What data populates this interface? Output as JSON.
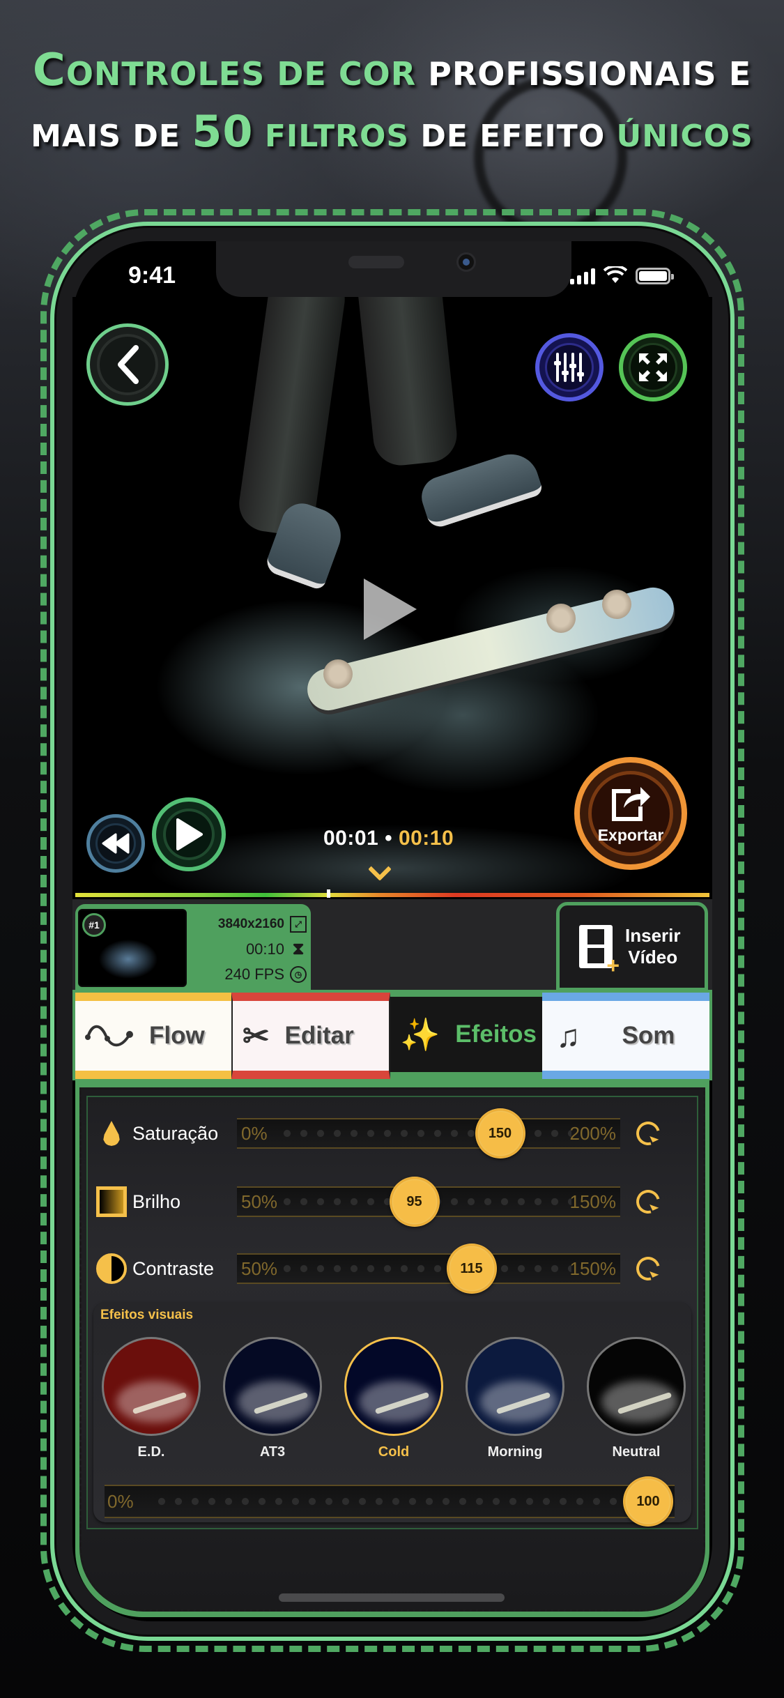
{
  "headline": {
    "line1": [
      {
        "text": "C",
        "color": "green",
        "cap": true
      },
      {
        "text": "ONTROLES DE COR ",
        "color": "green"
      },
      {
        "text": "PROFISSIONAIS E",
        "color": "white"
      }
    ],
    "line2": [
      {
        "text": "MAIS DE ",
        "color": "white"
      },
      {
        "text": "50",
        "color": "green",
        "big": true
      },
      {
        "text": " FILTROS ",
        "color": "green"
      },
      {
        "text": "DE EFEITO ",
        "color": "white"
      },
      {
        "text": "ÚNICOS",
        "color": "green"
      }
    ],
    "full_text": "Controles de cor profissionais e mais de 50 filtros de efeito únicos"
  },
  "status_bar": {
    "time": "9:41",
    "icons": [
      "cellular-signal-icon",
      "wifi-icon",
      "battery-icon"
    ]
  },
  "player": {
    "back_icon": "chevron-left-icon",
    "mixer_icon": "sliders-icon",
    "fullscreen_icon": "expand-icon",
    "center_play_icon": "play-icon",
    "rewind_icon": "rewind-icon",
    "play_icon": "play-icon",
    "current_time": "00:01",
    "separator": "•",
    "total_time": "00:10",
    "export_label": "Exportar",
    "export_icon": "share-icon",
    "collapse_icon": "chevron-down-icon",
    "progress": 0.1,
    "colors": {
      "back": "#6fcf8c",
      "mixer": "#5459e0",
      "fullscreen": "#55c456",
      "rewind": "#4f7f9e",
      "play": "#53bf75",
      "export": "#f09536",
      "total_time": "#f5c04a"
    }
  },
  "clip": {
    "badge": "#1",
    "resolution": "3840x2160",
    "duration": "00:10",
    "fps": "240 FPS",
    "icons": [
      "resolution-icon",
      "hourglass-icon",
      "fps-icon"
    ]
  },
  "insert_video": {
    "label_line1": "Inserir",
    "label_line2": "Vídeo",
    "icon": "film-add-icon"
  },
  "tabs": [
    {
      "label": "Flow",
      "icon": "wave-icon",
      "accent": "#f4c043",
      "active": false
    },
    {
      "label": "Editar",
      "icon": "scissors-icon",
      "accent": "#d9453b",
      "active": false
    },
    {
      "label": "Efeitos",
      "icon": "magic-wand-icon",
      "accent": "#5cbe69",
      "active": true
    },
    {
      "label": "Som",
      "icon": "music-note-icon",
      "accent": "#6aa8e5",
      "active": false
    }
  ],
  "adjustments": [
    {
      "label": "Saturação",
      "icon": "drop-icon",
      "min_label": "0%",
      "max_label": "200%",
      "value": "150",
      "min": 0,
      "max": 200,
      "current": 150
    },
    {
      "label": "Brilho",
      "icon": "brightness-square-icon",
      "min_label": "50%",
      "max_label": "150%",
      "value": "95",
      "min": 50,
      "max": 150,
      "current": 95
    },
    {
      "label": "Contraste",
      "icon": "contrast-icon",
      "min_label": "50%",
      "max_label": "150%",
      "value": "115",
      "min": 50,
      "max": 150,
      "current": 115
    }
  ],
  "effects": {
    "title": "Efeitos visuais",
    "items": [
      {
        "label": "E.D.",
        "tint": "#6b0f0c",
        "selected": false
      },
      {
        "label": "AT3",
        "tint": "#050a24",
        "selected": false
      },
      {
        "label": "Cold",
        "tint": "#030828",
        "selected": true
      },
      {
        "label": "Morning",
        "tint": "#0c1a3e",
        "selected": false
      },
      {
        "label": "Neutral",
        "tint": "#050505",
        "selected": false
      }
    ],
    "intensity": {
      "min_label": "0%",
      "value": "100",
      "fraction": 1.0
    }
  },
  "accent": {
    "green": "#7fdc93",
    "gold": "#f5c04a"
  }
}
